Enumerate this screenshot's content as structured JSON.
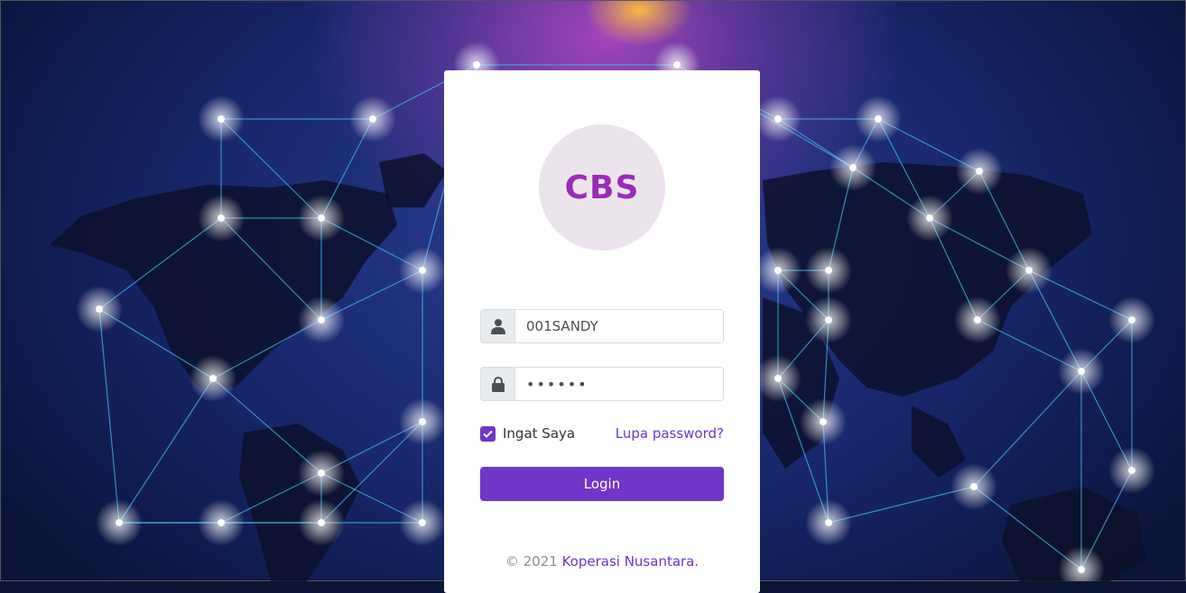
{
  "brand": {
    "logo_text": "CBS",
    "accent": "#6f36c8",
    "logo_color": "#9b2bb8"
  },
  "form": {
    "username": {
      "value": "001SANDY",
      "icon": "user-icon"
    },
    "password": {
      "value": "••••••",
      "icon": "lock-icon"
    },
    "remember": {
      "label": "Ingat Saya",
      "checked": true
    },
    "forgot_label": "Lupa password?",
    "login_label": "Login"
  },
  "footer": {
    "copyright": "© 2021",
    "org_link": "Koperasi Nusantara."
  }
}
